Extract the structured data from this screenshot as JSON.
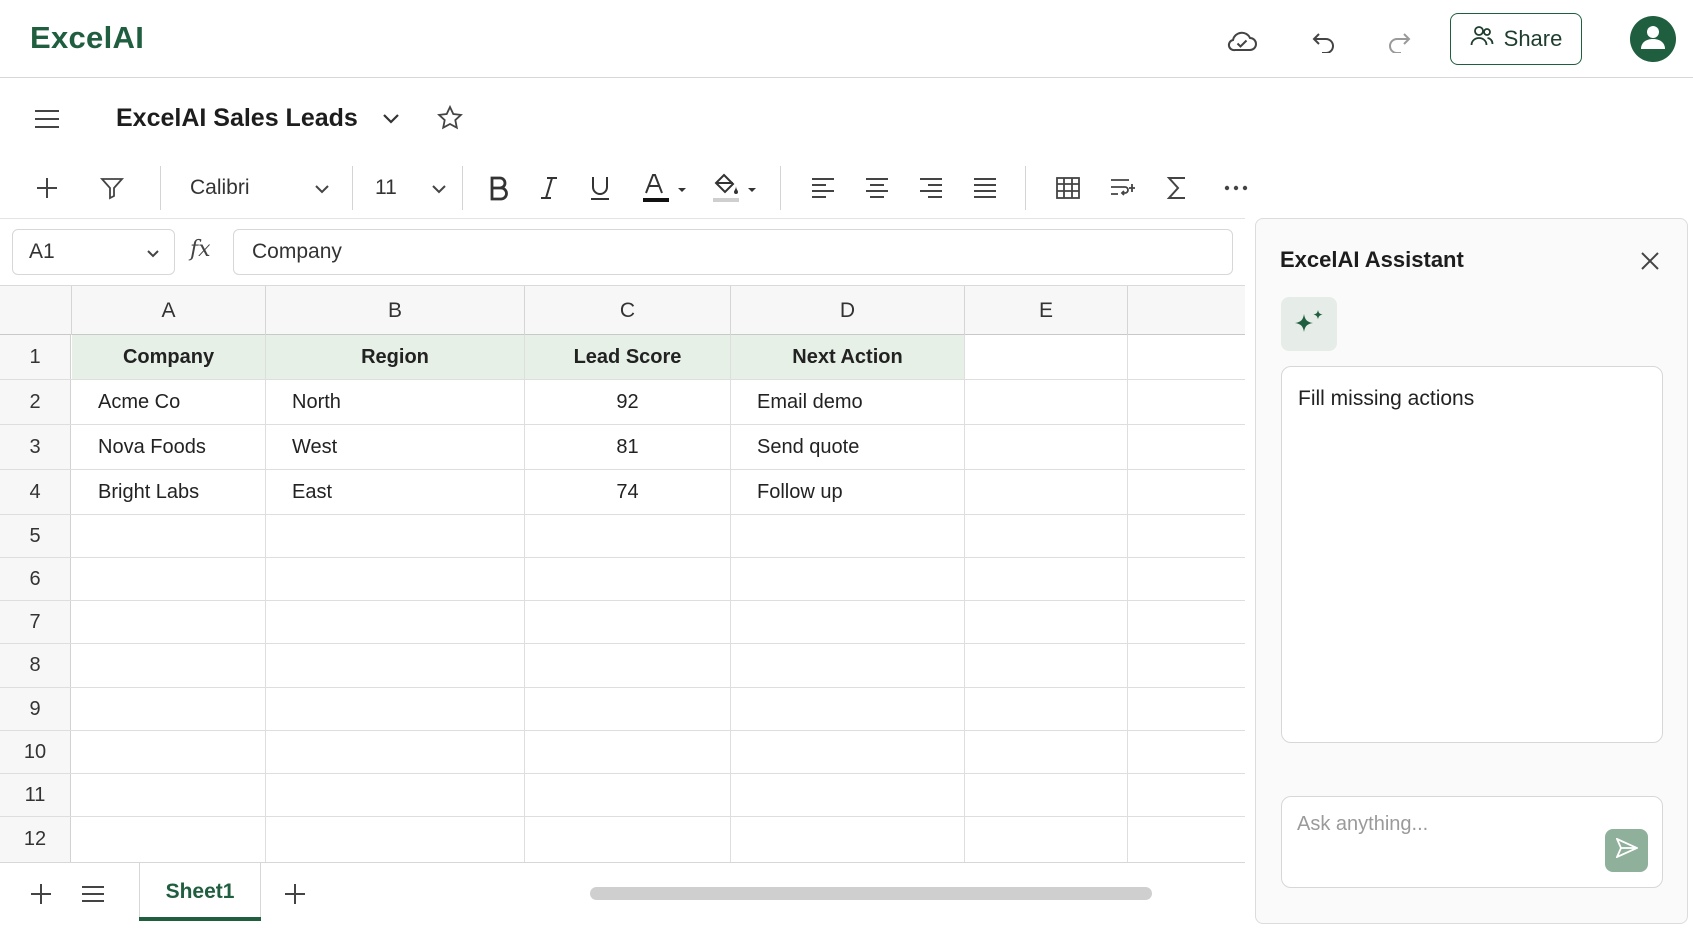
{
  "app": {
    "logo": "ExcelAI"
  },
  "header": {
    "share_label": "Share"
  },
  "document": {
    "title": "ExcelAI Sales Leads"
  },
  "toolbar": {
    "font": "Calibri",
    "font_size": "11",
    "font_color": "#111111"
  },
  "formula_bar": {
    "cell_ref": "A1",
    "fx_label": "fx",
    "value": "Company"
  },
  "grid": {
    "columns": [
      "A",
      "B",
      "C",
      "D",
      "E"
    ],
    "row_numbers": [
      "1",
      "2",
      "3",
      "4",
      "5",
      "6",
      "7",
      "8",
      "9",
      "10",
      "11",
      "12"
    ],
    "header": [
      "Company",
      "Region",
      "Lead Score",
      "Next Action"
    ],
    "rows": [
      [
        "Acme Co",
        "North",
        "92",
        "Email demo"
      ],
      [
        "Nova Foods",
        "West",
        "81",
        "Send quote"
      ],
      [
        "Bright Labs",
        "East",
        "74",
        "Follow up"
      ]
    ]
  },
  "sheets": {
    "tabs": [
      "Sheet1"
    ],
    "active": "Sheet1"
  },
  "assistant": {
    "title": "ExcelAI Assistant",
    "message": "Fill missing actions",
    "input_placeholder": "Ask anything..."
  },
  "colors": {
    "brand": "#1f5e3f",
    "header_fill": "#e6f0e7",
    "send_button": "#8fb09a"
  }
}
